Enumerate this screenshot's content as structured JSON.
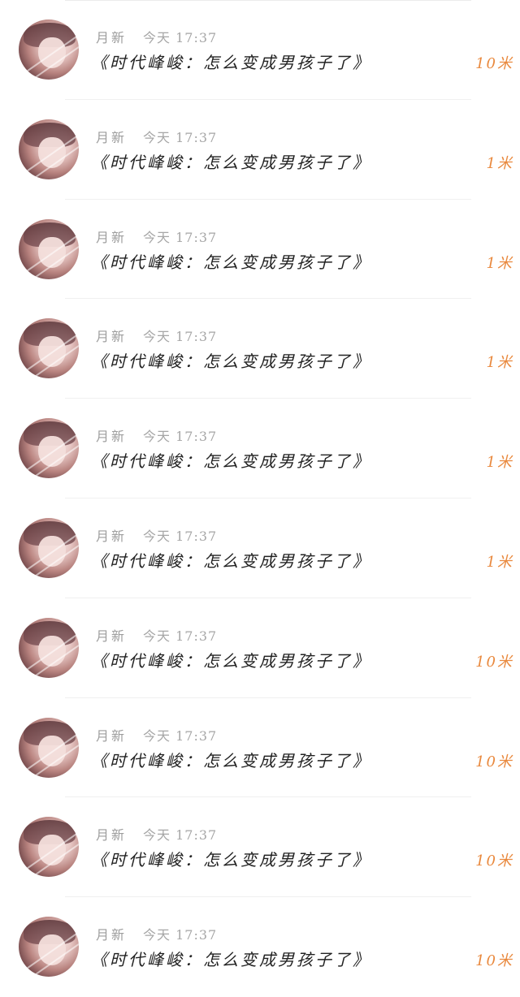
{
  "feed": {
    "items": [
      {
        "author": "月新",
        "time": "今天 17:37",
        "title": "《时代峰峻：怎么变成男孩子了》",
        "count": "10米"
      },
      {
        "author": "月新",
        "time": "今天 17:37",
        "title": "《时代峰峻：怎么变成男孩子了》",
        "count": "1米"
      },
      {
        "author": "月新",
        "time": "今天 17:37",
        "title": "《时代峰峻：怎么变成男孩子了》",
        "count": "1米"
      },
      {
        "author": "月新",
        "time": "今天 17:37",
        "title": "《时代峰峻：怎么变成男孩子了》",
        "count": "1米"
      },
      {
        "author": "月新",
        "time": "今天 17:37",
        "title": "《时代峰峻：怎么变成男孩子了》",
        "count": "1米"
      },
      {
        "author": "月新",
        "time": "今天 17:37",
        "title": "《时代峰峻：怎么变成男孩子了》",
        "count": "1米"
      },
      {
        "author": "月新",
        "time": "今天 17:37",
        "title": "《时代峰峻：怎么变成男孩子了》",
        "count": "10米"
      },
      {
        "author": "月新",
        "time": "今天 17:37",
        "title": "《时代峰峻：怎么变成男孩子了》",
        "count": "10米"
      },
      {
        "author": "月新",
        "time": "今天 17:37",
        "title": "《时代峰峻：怎么变成男孩子了》",
        "count": "10米"
      },
      {
        "author": "月新",
        "time": "今天 17:37",
        "title": "《时代峰峻：怎么变成男孩子了》",
        "count": "10米"
      }
    ]
  },
  "colors": {
    "count": "#e9893e",
    "meta": "#9d9d9d",
    "title": "#222222"
  },
  "icons": {
    "avatar": "user-avatar-photo"
  }
}
